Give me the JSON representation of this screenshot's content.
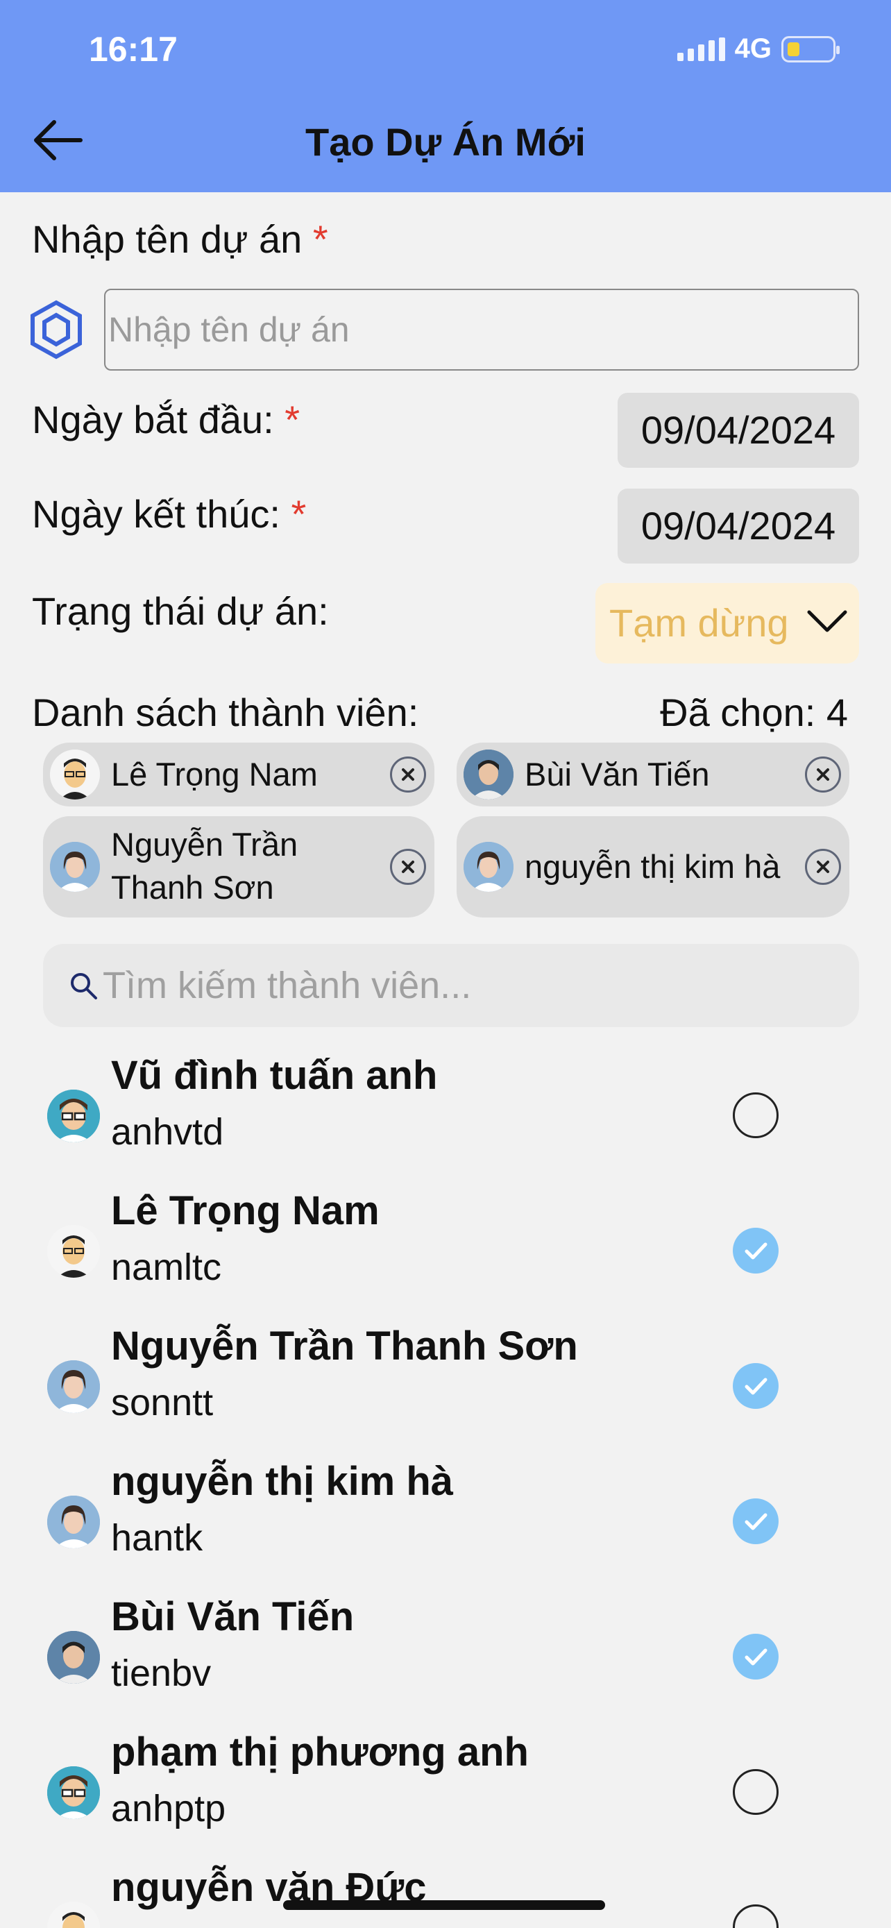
{
  "status_bar": {
    "time": "16:17",
    "network": "4G"
  },
  "header": {
    "title": "Tạo Dự Án Mới"
  },
  "form": {
    "name_label": "Nhập tên dự án",
    "name_placeholder": "Nhập tên dự án",
    "required_mark": "*",
    "start_label": "Ngày bắt đầu:",
    "start_date": "09/04/2024",
    "end_label": "Ngày kết thúc:",
    "end_date": "09/04/2024",
    "status_label": "Trạng thái dự án:",
    "status_value": "Tạm dừng"
  },
  "members": {
    "label": "Danh sách thành viên:",
    "selected_text": "Đã chọn: 4",
    "selected_chips": [
      {
        "name": "Lê Trọng Nam",
        "avatar": "cartoon-avatar-icon"
      },
      {
        "name": "Bùi Văn Tiến",
        "avatar": "photo-avatar-icon"
      },
      {
        "name": "Nguyễn Trần Thanh Sơn",
        "avatar": "photo-avatar-icon"
      },
      {
        "name": "nguyễn thị kim hà",
        "avatar": "photo-avatar-icon"
      }
    ],
    "search_placeholder": "Tìm kiếm thành viên...",
    "list": [
      {
        "name": "Vũ đình tuấn anh",
        "username": "anhvtd",
        "checked": false
      },
      {
        "name": "Lê Trọng Nam",
        "username": "namltc",
        "checked": true
      },
      {
        "name": "Nguyễn Trần Thanh Sơn",
        "username": "sonntt",
        "checked": true
      },
      {
        "name": "nguyễn thị kim hà",
        "username": "hantk",
        "checked": true
      },
      {
        "name": "Bùi Văn Tiến",
        "username": "tienbv",
        "checked": true
      },
      {
        "name": "phạm thị phương anh",
        "username": "anhptp",
        "checked": false
      },
      {
        "name": "nguyễn văn Đức",
        "username": "",
        "checked": false
      }
    ]
  },
  "colors": {
    "header": "#6f98f5",
    "required": "#e23b2f",
    "status_bg": "#fdf1d8",
    "status_text": "#e6b95e",
    "check": "#80c4f6"
  }
}
